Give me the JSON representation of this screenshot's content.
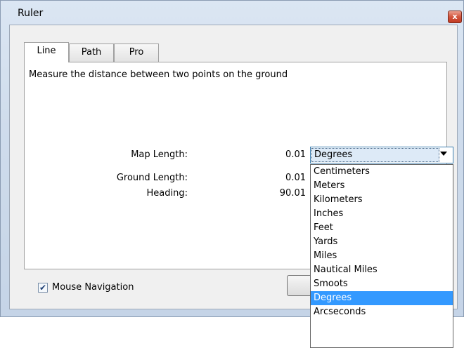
{
  "window": {
    "title": "Ruler",
    "close_glyph": "x"
  },
  "tabs": [
    {
      "label": "Line",
      "active": true
    },
    {
      "label": "Path",
      "active": false
    },
    {
      "label": "Pro",
      "active": false
    }
  ],
  "panel": {
    "description": "Measure the distance between two points on the ground",
    "map_length_label": "Map Length:",
    "map_length_value": "0.01",
    "ground_length_label": "Ground Length:",
    "ground_length_value": "0.01",
    "heading_label": "Heading:",
    "heading_value": "90.01"
  },
  "units": {
    "selected": "Degrees",
    "options": [
      "Centimeters",
      "Meters",
      "Kilometers",
      "Inches",
      "Feet",
      "Yards",
      "Miles",
      "Nautical Miles",
      "Smoots",
      "Degrees",
      "Arcseconds"
    ]
  },
  "footer": {
    "mouse_navigation_label": "Mouse Navigation",
    "mouse_navigation_checked": true
  },
  "colors": {
    "selection": "#3399ff",
    "close_button": "#c13a22"
  }
}
